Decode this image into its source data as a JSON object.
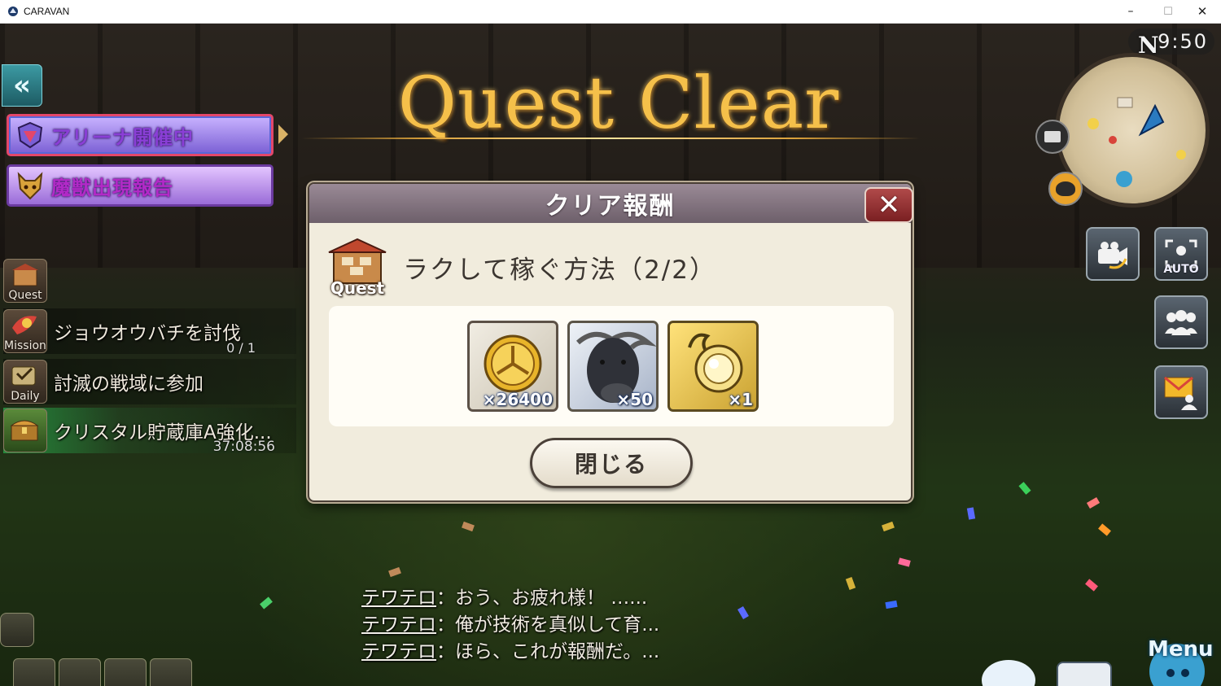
{
  "window": {
    "title": "CARAVAN",
    "controls": {
      "minimize": "–",
      "maximize": "☐",
      "close": "✕"
    }
  },
  "hud": {
    "back_label": "«",
    "banners": [
      {
        "label": "アリーナ開催中"
      },
      {
        "label": "魔獣出現報告"
      }
    ],
    "time": "9:50",
    "compass": "N",
    "side_buttons": {
      "auto_label": "AUTO"
    },
    "menu_label": "Menu"
  },
  "quest_clear_title": "Quest Clear",
  "side_list": {
    "quest_tab": {
      "label": "Quest"
    },
    "mission": {
      "tab_label": "Mission",
      "task": "ジョウオウバチを討伐",
      "progress": "0 / 1"
    },
    "daily": {
      "tab_label": "Daily",
      "task": "討滅の戦域に参加"
    },
    "crystal": {
      "task": "クリスタル貯蔵庫A強化...",
      "timer": "37:08:56"
    }
  },
  "modal": {
    "title": "クリア報酬",
    "close_icon": "close-x-icon",
    "quest_icon_label": "Quest",
    "quest_name": "ラクして稼ぐ方法（2/2）",
    "rewards": [
      {
        "icon": "gil-coin-icon",
        "qty": "×26400"
      },
      {
        "icon": "buffalo-icon",
        "qty": "×50"
      },
      {
        "icon": "golden-orb-icon",
        "qty": "×1"
      }
    ],
    "close_button_label": "閉じる"
  },
  "chat": [
    {
      "speaker": "テワテロ",
      "sep": "：",
      "text": "おう、お疲れ様！ …..."
    },
    {
      "speaker": "テワテロ",
      "sep": "：",
      "text": "俺が技術を真似して育..."
    },
    {
      "speaker": "テワテロ",
      "sep": "：",
      "text": "ほら、これが報酬だ。..."
    }
  ],
  "colors": {
    "quest_title_gold": "#f5c04a",
    "modal_bg": "#f1ecdd",
    "modal_header": "#7d6e79",
    "close_red": "#9a3235"
  }
}
